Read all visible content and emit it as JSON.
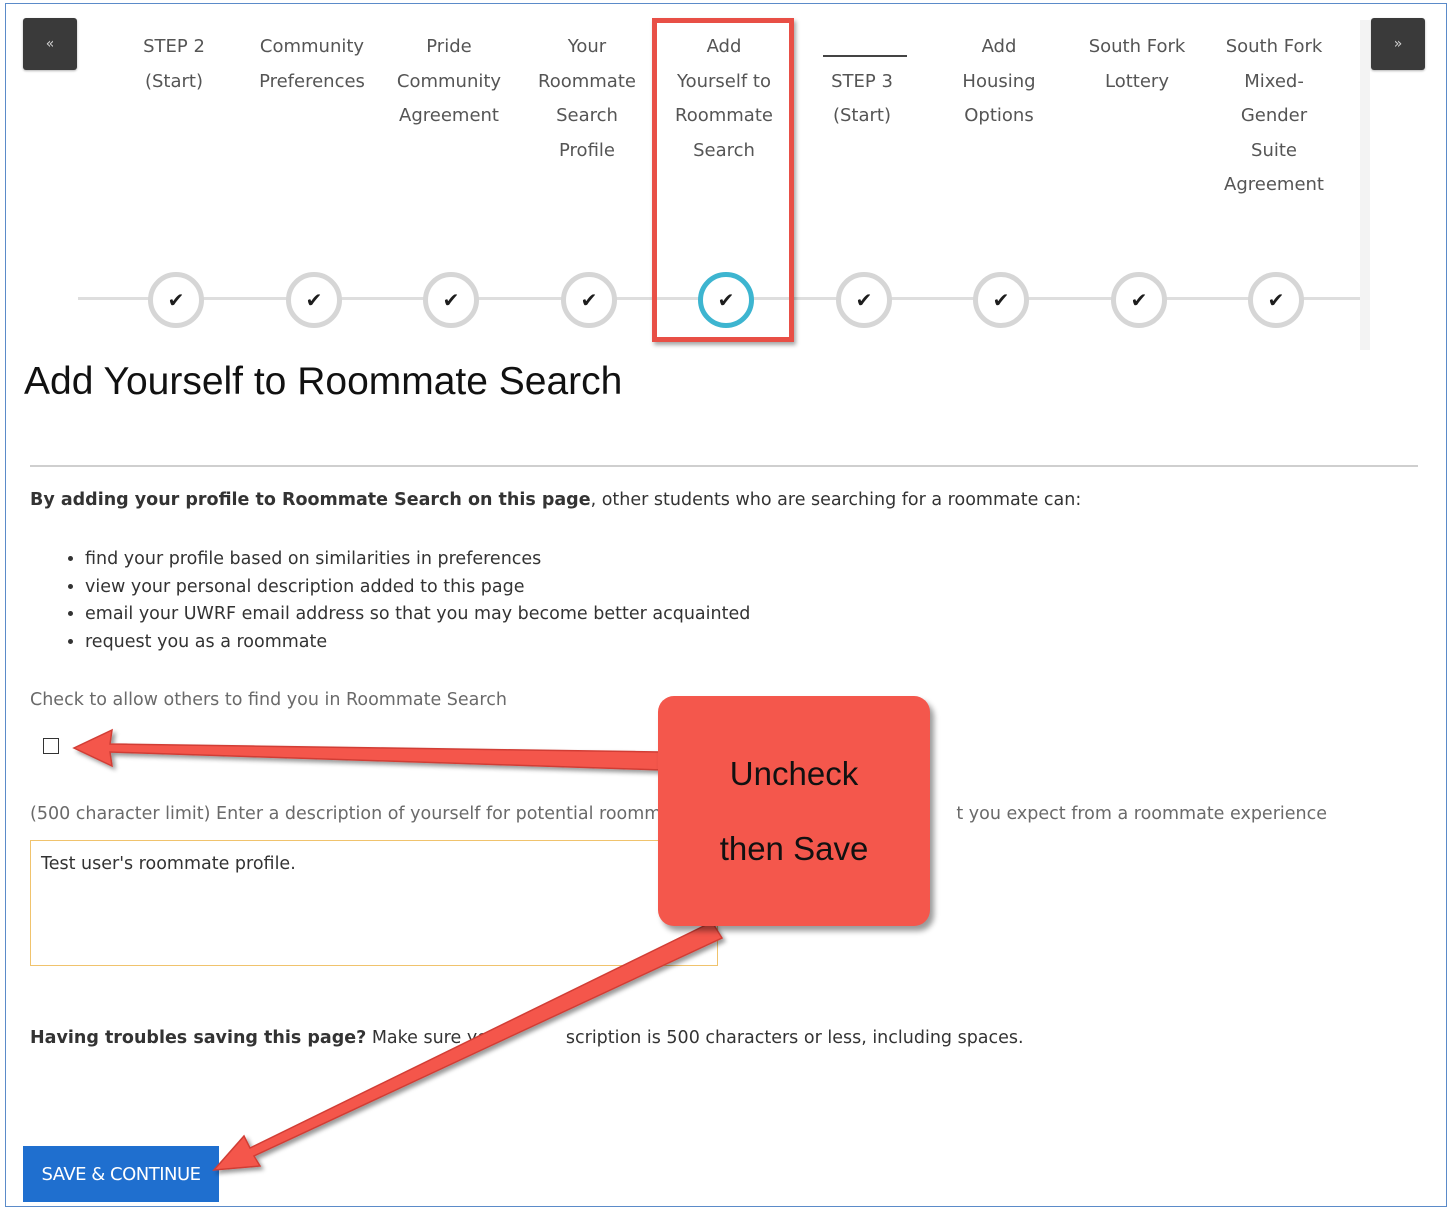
{
  "nav": {
    "prev_icon": "«",
    "next_icon": "»"
  },
  "steps": [
    {
      "label": "STEP 2\n(Start)"
    },
    {
      "label": "Community\nPreferences"
    },
    {
      "label": "Pride\nCommunity\nAgreement"
    },
    {
      "label": "Your\nRoommate\nSearch\nProfile"
    },
    {
      "label": "Add\nYourself to\nRoommate\nSearch"
    },
    {
      "label": "STEP 3\n(Start)"
    },
    {
      "label": "Add\nHousing\nOptions"
    },
    {
      "label": "South Fork\nLottery"
    },
    {
      "label": "South Fork\nMixed-\nGender\nSuite\nAgreement"
    }
  ],
  "step_check_glyph": "✔",
  "page": {
    "title": "Add Yourself to Roommate Search",
    "intro_bold": "By adding your profile to Roommate Search on this page",
    "intro_rest": ", other students who are searching for a roommate can:",
    "bullets": [
      "find your profile based on similarities in preferences",
      "view your personal description added to this page",
      "email your UWRF email address so that you may become better acquainted",
      "request you as a roommate"
    ],
    "check_label": "Check to allow others to find you in Roommate Search",
    "checkbox_checked": false,
    "desc_label_left": "(500 character limit) Enter a description of yourself for potential roomm",
    "desc_label_right": "t you expect from a roommate experience",
    "desc_value": "Test user's roommate profile.",
    "trouble_bold": "Having troubles saving this page?",
    "trouble_left": " Make sure yo",
    "trouble_right": "scription is 500 characters or less, including spaces.",
    "save_label": "SAVE & CONTINUE"
  },
  "annotation": {
    "line1": "Uncheck",
    "line2": "then Save",
    "color": "#f4574c",
    "highlight_color": "#e84f46"
  }
}
